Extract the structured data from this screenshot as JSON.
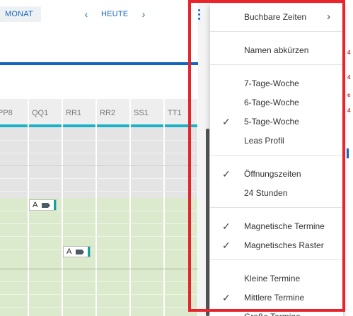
{
  "toolbar": {
    "monat_label": "MONAT",
    "heute_label": "HEUTE",
    "prev_glyph": "‹",
    "next_glyph": "›"
  },
  "progress": {
    "fraction": 1.0,
    "color": "#1565c0"
  },
  "calendar": {
    "columns": [
      "PP8",
      "QQ1",
      "RR1",
      "RR2",
      "SS1",
      "TT1"
    ],
    "header_accent": "#1ab2c5",
    "grey_zone_color": "#e4e4e4",
    "green_zone_color": "#dbe9cc",
    "appointments": [
      {
        "column": "QQ1",
        "label": "A"
      },
      {
        "column": "RR1",
        "label": "A"
      }
    ]
  },
  "menu": {
    "groups": [
      [
        {
          "label": "Buchbare Zeiten",
          "checked": false,
          "submenu": true
        }
      ],
      [
        {
          "label": "Namen abkürzen",
          "checked": false
        }
      ],
      [
        {
          "label": "7-Tage-Woche",
          "checked": false
        },
        {
          "label": "6-Tage-Woche",
          "checked": false
        },
        {
          "label": "5-Tage-Woche",
          "checked": true
        },
        {
          "label": "Leas Profil",
          "checked": false
        }
      ],
      [
        {
          "label": "Öffnungszeiten",
          "checked": true
        },
        {
          "label": "24 Stunden",
          "checked": false
        }
      ],
      [
        {
          "label": "Magnetische Termine",
          "checked": true
        },
        {
          "label": "Magnetisches Raster",
          "checked": true
        }
      ],
      [
        {
          "label": "Kleine Termine",
          "checked": false
        },
        {
          "label": "Mittlere Termine",
          "checked": true
        },
        {
          "label": "Große Termine",
          "checked": false
        }
      ]
    ],
    "check_glyph": "✓",
    "submenu_glyph": "›"
  },
  "highlight_color": "#e8232b"
}
